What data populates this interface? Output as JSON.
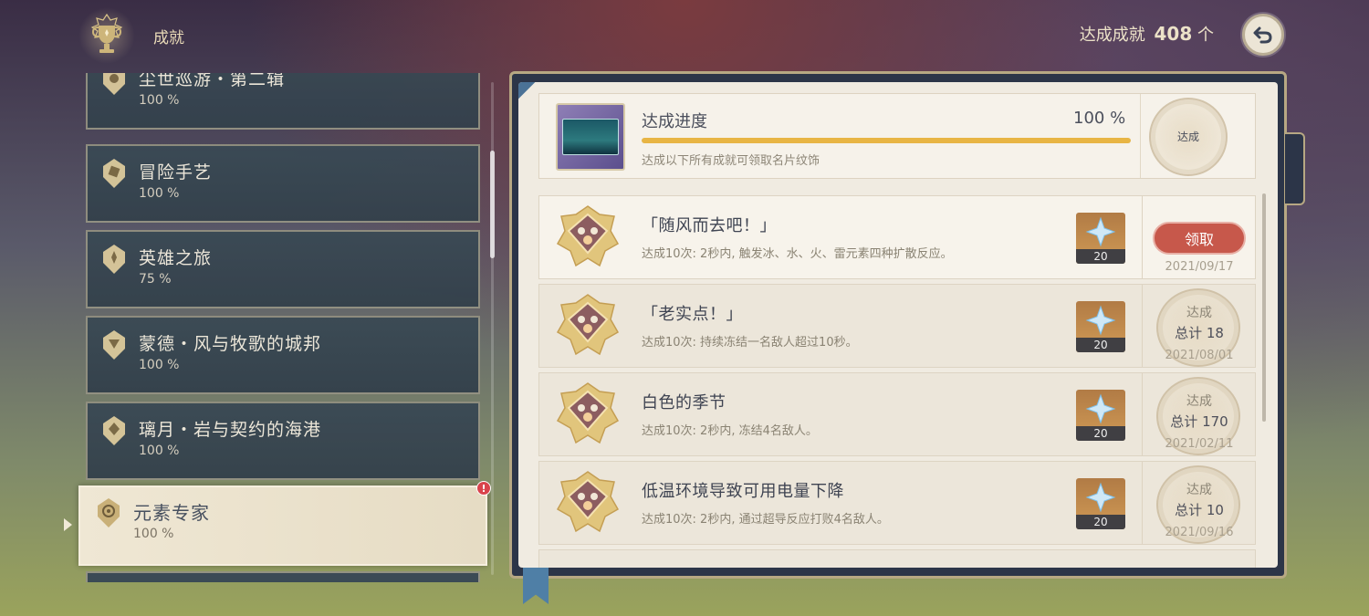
{
  "header": {
    "title": "成就",
    "count_label": "达成成就",
    "count_value": "408",
    "count_unit": "个"
  },
  "categories": [
    {
      "name": "尘世巡游・第二辑",
      "pct": "100 %"
    },
    {
      "name": "冒险手艺",
      "pct": "100 %"
    },
    {
      "name": "英雄之旅",
      "pct": "75 %"
    },
    {
      "name": "蒙德・风与牧歌的城邦",
      "pct": "100 %"
    },
    {
      "name": "璃月・岩与契约的海港",
      "pct": "100 %"
    }
  ],
  "active_category": {
    "name": "元素专家",
    "pct": "100 %",
    "alert": "!"
  },
  "progress": {
    "title": "达成进度",
    "pct": "100 %",
    "value": 100,
    "desc": "达成以下所有成就可领取名片纹饰",
    "seal_label": "达成"
  },
  "achievements": [
    {
      "title": "「随风而去吧！」",
      "desc": "达成10次: 2秒内, 触发冰、水、火、雷元素四种扩散反应。",
      "reward_qty": "20",
      "claim_label": "领取",
      "date": "2021/09/17"
    },
    {
      "title": "「老实点！」",
      "desc": "达成10次: 持续冻结一名敌人超过10秒。",
      "reward_qty": "20",
      "seal_t1": "达成",
      "seal_t2": "总计 18",
      "date": "2021/08/01"
    },
    {
      "title": "白色的季节",
      "desc": "达成10次: 2秒内, 冻结4名敌人。",
      "reward_qty": "20",
      "seal_t1": "达成",
      "seal_t2": "总计 170",
      "date": "2021/02/11"
    },
    {
      "title": "低温环境导致可用电量下降",
      "desc": "达成10次: 2秒内, 通过超导反应打败4名敌人。",
      "reward_qty": "20",
      "seal_t1": "达成",
      "seal_t2": "总计 10",
      "date": "2021/09/16"
    }
  ],
  "icons": {
    "trophy": "trophy-emblem-icon",
    "back": "back-arrow-icon",
    "reward": "primogem-icon",
    "medal": "achievement-medal-icon"
  },
  "colors": {
    "accent_gold": "#e8b544",
    "claim_red": "#c7584b",
    "panel_navy": "#2c3548"
  }
}
